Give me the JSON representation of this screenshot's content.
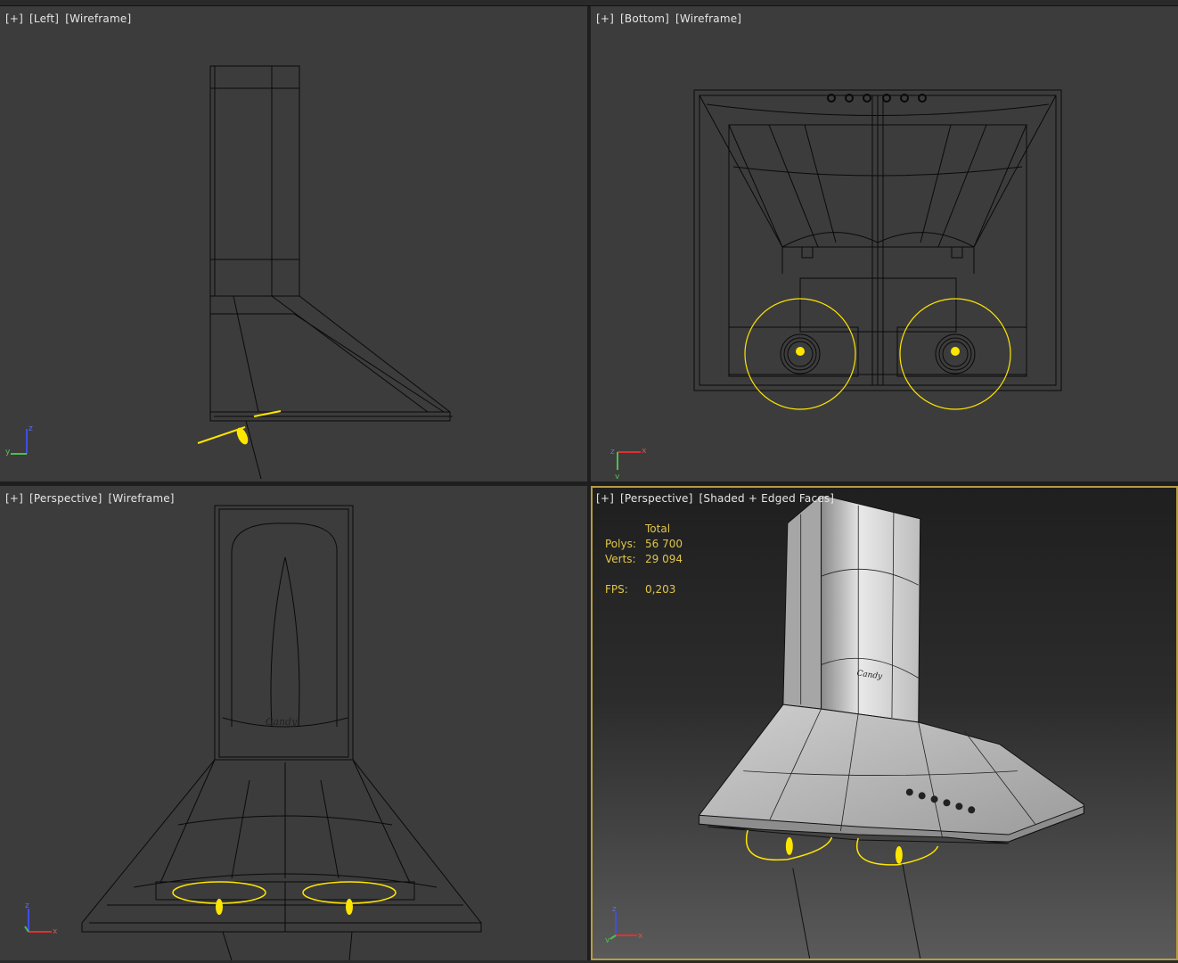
{
  "viewports": {
    "left": {
      "plus": "[+]",
      "view": "[Left]",
      "mode": "[Wireframe]"
    },
    "bottom": {
      "plus": "[+]",
      "view": "[Bottom]",
      "mode": "[Wireframe]"
    },
    "persp_wire": {
      "plus": "[+]",
      "view": "[Perspective]",
      "mode": "[Wireframe]"
    },
    "persp_shaded": {
      "plus": "[+]",
      "view": "[Perspective]",
      "mode": "[Shaded + Edged Faces]"
    }
  },
  "stats": {
    "header": "Total",
    "polys_label": "Polys:",
    "polys_value": "56 700",
    "verts_label": "Verts:",
    "verts_value": "29 094",
    "fps_label": "FPS:",
    "fps_value": "0,203"
  },
  "gizmo_axes": {
    "x": "x",
    "y": "y",
    "z": "z"
  },
  "colors": {
    "viewport_bg": "#3c3c3c",
    "wire": "#0a0a0a",
    "light": "#ffe600",
    "active_border": "#b59d45",
    "stats_text": "#e0c64a"
  }
}
